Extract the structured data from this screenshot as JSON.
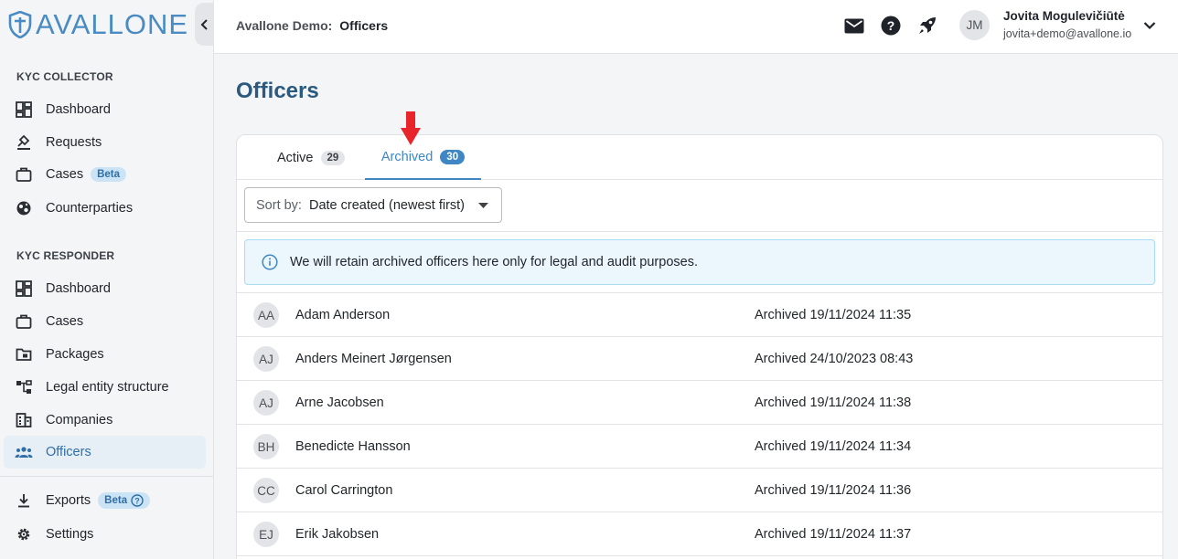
{
  "brand": {
    "name": "AVALLONE"
  },
  "sidebar": {
    "collector_label": "KYC COLLECTOR",
    "collector_items": [
      {
        "label": "Dashboard",
        "icon": "dashboard-icon"
      },
      {
        "label": "Requests",
        "icon": "stamp-icon"
      },
      {
        "label": "Cases",
        "icon": "briefcase-icon",
        "badge": "Beta"
      },
      {
        "label": "Counterparties",
        "icon": "globe-icon"
      }
    ],
    "responder_label": "KYC RESPONDER",
    "responder_items": [
      {
        "label": "Dashboard",
        "icon": "dashboard-icon"
      },
      {
        "label": "Cases",
        "icon": "briefcase-icon"
      },
      {
        "label": "Packages",
        "icon": "folder-icon"
      },
      {
        "label": "Legal entity structure",
        "icon": "hierarchy-icon"
      },
      {
        "label": "Companies",
        "icon": "building-icon"
      },
      {
        "label": "Officers",
        "icon": "people-icon",
        "active": true
      }
    ],
    "bottom_items": [
      {
        "label": "Exports",
        "icon": "download-icon",
        "badge": "Beta"
      },
      {
        "label": "Settings",
        "icon": "gear-icon"
      }
    ]
  },
  "topbar": {
    "org": "Avallone Demo:",
    "page": "Officers",
    "user": {
      "initials": "JM",
      "name": "Jovita Mogulevičiūtė",
      "email": "jovita+demo@avallone.io"
    }
  },
  "main": {
    "title": "Officers",
    "tabs": [
      {
        "label": "Active",
        "count": "29"
      },
      {
        "label": "Archived",
        "count": "30"
      }
    ],
    "sort": {
      "label": "Sort by:",
      "value": "Date created (newest first)"
    },
    "info": "We will retain archived officers here only for legal and audit purposes.",
    "officers": [
      {
        "initials": "AA",
        "name": "Adam Anderson",
        "archived": "Archived 19/11/2024 11:35"
      },
      {
        "initials": "AJ",
        "name": "Anders Meinert Jørgensen",
        "archived": "Archived 24/10/2023 08:43"
      },
      {
        "initials": "AJ",
        "name": "Arne Jacobsen",
        "archived": "Archived 19/11/2024 11:38"
      },
      {
        "initials": "BH",
        "name": "Benedicte Hansson",
        "archived": "Archived 19/11/2024 11:34"
      },
      {
        "initials": "CC",
        "name": "Carol Carrington",
        "archived": "Archived 19/11/2024 11:36"
      },
      {
        "initials": "EJ",
        "name": "Erik Jakobsen",
        "archived": "Archived 19/11/2024 11:37"
      }
    ]
  },
  "colors": {
    "accent": "#3f86c4",
    "title": "#2b5a7e",
    "annotation_arrow": "#e8252a"
  }
}
